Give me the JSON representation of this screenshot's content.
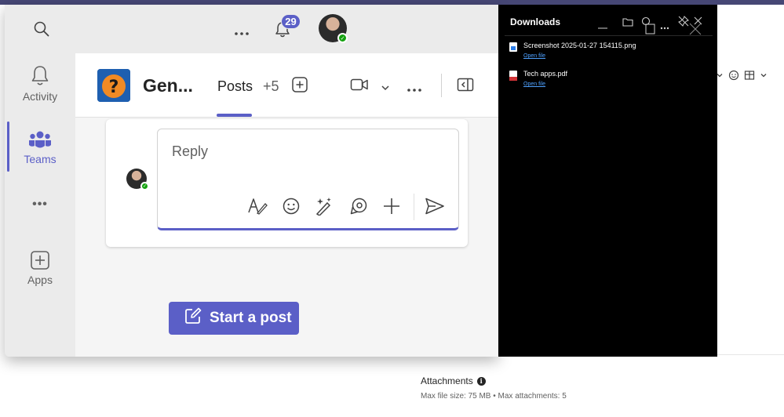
{
  "teams": {
    "notifications_count": "29",
    "rail": {
      "activity_label": "Activity",
      "teams_label": "Teams",
      "more_label": "•••",
      "apps_label": "Apps"
    },
    "channel": {
      "title": "Gen...",
      "tab_posts": "Posts",
      "more_tabs": "+5"
    },
    "reply": {
      "placeholder": "Reply"
    },
    "start_post_label": "Start a post"
  },
  "downloads": {
    "title": "Downloads",
    "items": [
      {
        "name": "Screenshot 2025-01-27 154115.png",
        "action": "Open file",
        "icon": "image-file-icon"
      },
      {
        "name": "Tech apps.pdf",
        "action": "Open file",
        "icon": "pdf-file-icon"
      }
    ]
  },
  "background_page": {
    "attachments_label": "Attachments",
    "attachments_info": "Max file size: 75 MB • Max attachments: 5"
  },
  "colors": {
    "brand": "#5b5fc7",
    "presence": "#13a10e",
    "downloads_bg": "#000000",
    "link": "#4ea1ff"
  }
}
